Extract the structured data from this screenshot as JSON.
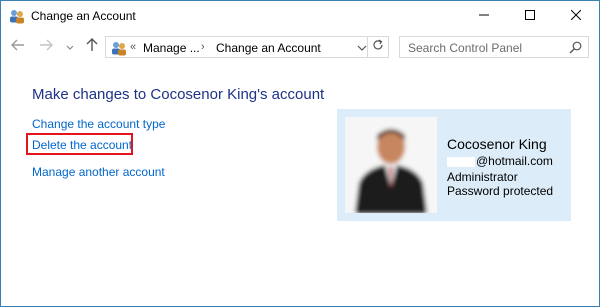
{
  "window": {
    "title": "Change an Account",
    "icon": "users-icon",
    "controls": [
      "minimize-icon",
      "maximize-icon",
      "close-icon"
    ]
  },
  "address_bar": {
    "chevrons": "«",
    "segments": [
      "Manage ...",
      "Change an Account"
    ],
    "separator": "›"
  },
  "search": {
    "placeholder": "Search Control Panel"
  },
  "main": {
    "heading": "Make changes to Cocosenor King's account",
    "links": {
      "change_type": "Change the account type",
      "delete": "Delete the account",
      "manage": "Manage another account"
    }
  },
  "account": {
    "name": "Cocosenor King",
    "email_visible": "@hotmail.com",
    "role": "Administrator",
    "status": "Password protected"
  },
  "colors": {
    "heading": "#1e3287",
    "link": "#0066cc",
    "card_bg": "#dcecf8",
    "highlight": "#e3141c"
  }
}
